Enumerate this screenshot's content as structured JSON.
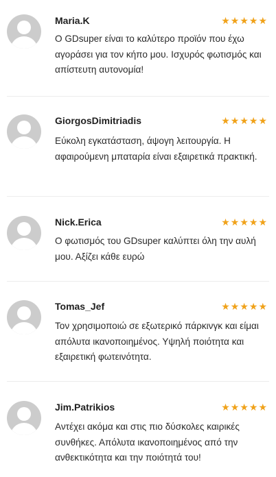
{
  "reviews": [
    {
      "author": "Maria.K",
      "rating": 5,
      "stars": "★★★★★",
      "text": "Ο GDsuper είναι το καλύτερο προϊόν που έχω αγοράσει για τον κήπο μου. Ισχυρός φωτισμός και απίστευτη αυτονομία!",
      "avatar_icon": "default-user-avatar-icon"
    },
    {
      "author": "GiorgosDimitriadis",
      "rating": 5,
      "stars": "★★★★★",
      "text": "Εύκολη εγκατάσταση, άψογη λειτουργία. Η αφαιρούμενη μπαταρία είναι εξαιρετικά πρακτική.",
      "avatar_icon": "default-user-avatar-icon"
    },
    {
      "author": "Nick.Erica",
      "rating": 5,
      "stars": "★★★★★",
      "text": "Ο φωτισμός του GDsuper καλύπτει όλη την αυλή μου. Αξίζει κάθε ευρώ",
      "avatar_icon": "default-user-avatar-icon"
    },
    {
      "author": "Tomas_Jef",
      "rating": 5,
      "stars": "★★★★★",
      "text": "Τον χρησιμοποιώ σε εξωτερικό πάρκινγκ και είμαι απόλυτα ικανοποιημένος. Υψηλή ποιότητα και εξαιρετική φωτεινότητα.",
      "avatar_icon": "default-user-avatar-icon"
    },
    {
      "author": "Jim.Patrikios",
      "rating": 5,
      "stars": "★★★★★",
      "text": "Αντέχει ακόμα και στις πιο δύσκολες καιρικές συνθήκες. Απόλυτα ικανοποιημένος από την ανθεκτικότητα και την ποιότητά του!",
      "avatar_icon": "default-user-avatar-icon"
    }
  ],
  "colors": {
    "star": "#f0a21a",
    "avatar_bg": "#cccccc",
    "divider": "#ececec"
  }
}
